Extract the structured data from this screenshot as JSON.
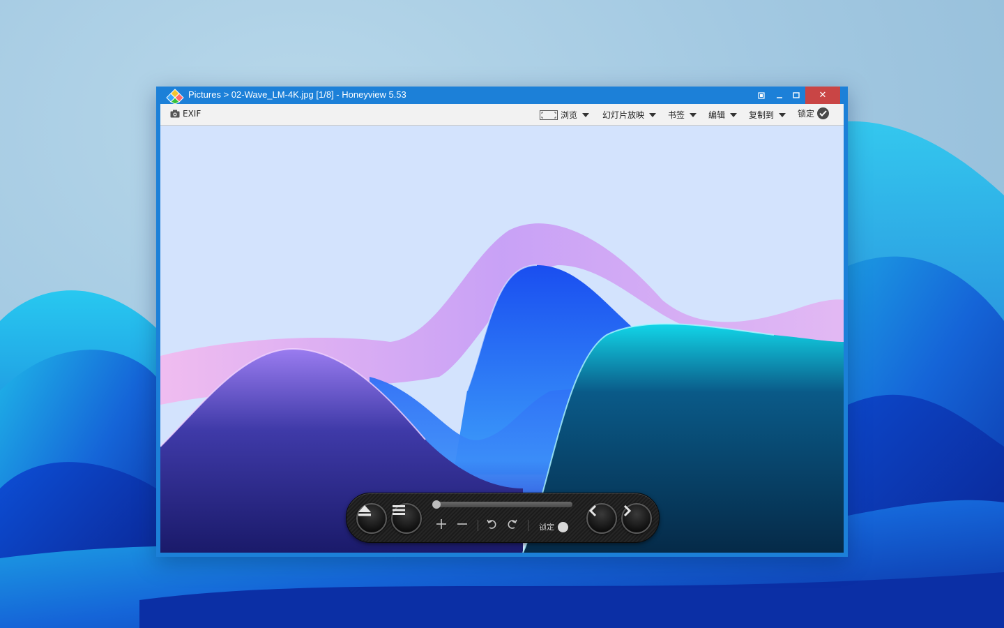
{
  "window": {
    "title": "Pictures > 02-Wave_LM-4K.jpg [1/8] - Honeyview 5.53",
    "controls": {
      "fullscreen": "fullscreen",
      "minimize": "minimize",
      "maximize": "maximize",
      "close": "✕"
    }
  },
  "menubar": {
    "exif_label": "EXIF",
    "items": [
      {
        "label": "浏览",
        "icon": "film-frame-icon"
      },
      {
        "label": "幻灯片放映"
      },
      {
        "label": "书签"
      },
      {
        "label": "编辑"
      },
      {
        "label": "复制到"
      }
    ],
    "lock_label": "锁定"
  },
  "osd": {
    "lock_label": "锁定",
    "progress": 0.0,
    "buttons": [
      "eject-icon",
      "menu-icon",
      "zoom-in-icon",
      "zoom-out-icon",
      "rotate-left-icon",
      "rotate-right-icon",
      "previous-icon",
      "next-icon"
    ]
  },
  "colors": {
    "titlebar": "#1c80d8",
    "close": "#c94545",
    "image_sky": "#d3e3fd"
  }
}
